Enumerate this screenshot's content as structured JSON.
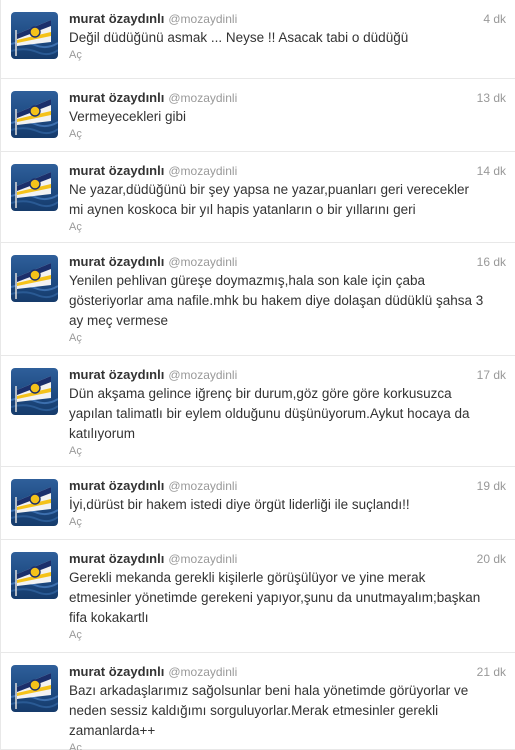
{
  "timeline": {
    "expand_label": "Aç",
    "tweets": [
      {
        "name": "murat özaydınlı",
        "handle": "@mozaydinli",
        "time": "4 dk",
        "lines": [
          "Değil düdüğünü asmak ... Neyse !! Asacak tabi o düdüğü"
        ]
      },
      {
        "name": "murat özaydınlı",
        "handle": "@mozaydinli",
        "time": "13 dk",
        "lines": [
          "Vermeyecekleri gibi"
        ]
      },
      {
        "name": "murat özaydınlı",
        "handle": "@mozaydinli",
        "time": "14 dk",
        "lines": [
          "Ne yazar,düdüğünü bir şey yapsa ne yazar,puanları geri verecekler",
          "mi aynen koskoca bir yıl hapis yatanların o bir yıllarını geri"
        ]
      },
      {
        "name": "murat özaydınlı",
        "handle": "@mozaydinli",
        "time": "16 dk",
        "lines": [
          "Yenilen pehlivan güreşe doymazmış,hala son kale için çaba",
          "gösteriyorlar ama nafile.mhk bu hakem diye dolaşan düdüklü şahsa 3",
          "ay meç vermese"
        ]
      },
      {
        "name": "murat özaydınlı",
        "handle": "@mozaydinli",
        "time": "17 dk",
        "lines": [
          "Dün akşama gelince iğrenç bir durum,göz göre göre korkusuzca",
          "yapılan talimatlı bir eylem olduğunu düşünüyorum.Aykut hocaya da",
          "katılıyorum"
        ]
      },
      {
        "name": "murat özaydınlı",
        "handle": "@mozaydinli",
        "time": "19 dk",
        "lines": [
          "İyi,dürüst bir hakem istedi diye örgüt liderliği ile suçlandı!!"
        ]
      },
      {
        "name": "murat özaydınlı",
        "handle": "@mozaydinli",
        "time": "20 dk",
        "lines": [
          "Gerekli mekanda gerekli kişilerle görüşülüyor ve yine merak",
          "etmesinler yönetimde gerekeni yapıyor,şunu da unutmayalım;başkan",
          "fifa kokakartlı"
        ]
      },
      {
        "name": "murat özaydınlı",
        "handle": "@mozaydinli",
        "time": "21 dk",
        "lines": [
          "Bazı arkadaşlarımız sağolsunlar beni hala yönetimde görüyorlar ve",
          "neden sessiz kaldığımı sorguluyorlar.Merak etmesinler gerekli",
          "zamanlarda++"
        ]
      }
    ]
  }
}
